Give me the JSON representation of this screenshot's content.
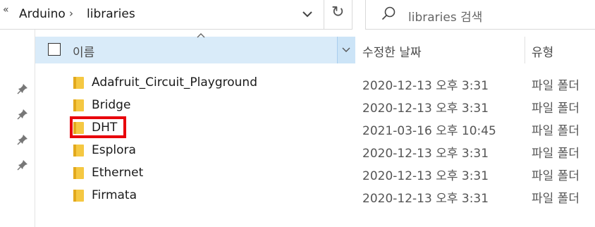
{
  "address_bar": {
    "more_glyph": "«",
    "breadcrumb": [
      "Arduino",
      "libraries"
    ],
    "separator": "›",
    "refresh_glyph": "↻"
  },
  "search": {
    "placeholder": "libraries 검색"
  },
  "header": {
    "name_label": "이름",
    "date_label": "수정한 날짜",
    "type_label": "유형"
  },
  "files": [
    {
      "name": "Adafruit_Circuit_Playground",
      "date": "2020-12-13 오후 3:31",
      "type": "파일 폴더"
    },
    {
      "name": "Bridge",
      "date": "2020-12-13 오후 3:31",
      "type": "파일 폴더"
    },
    {
      "name": "DHT",
      "date": "2021-03-16 오후 10:45",
      "type": "파일 폴더",
      "highlighted": true
    },
    {
      "name": "Esplora",
      "date": "2020-12-13 오후 3:31",
      "type": "파일 폴더"
    },
    {
      "name": "Ethernet",
      "date": "2020-12-13 오후 3:31",
      "type": "파일 폴더"
    },
    {
      "name": "Firmata",
      "date": "2020-12-13 오후 3:31",
      "type": "파일 폴더"
    }
  ],
  "colors": {
    "header_bg": "#d9ebf9",
    "folder_yellow": "#f5c842",
    "highlight_border": "#e8000b"
  },
  "icons": [
    "search-icon",
    "refresh-icon",
    "chevron-down-icon",
    "pin-icon",
    "folder-icon",
    "sort-up-icon"
  ]
}
